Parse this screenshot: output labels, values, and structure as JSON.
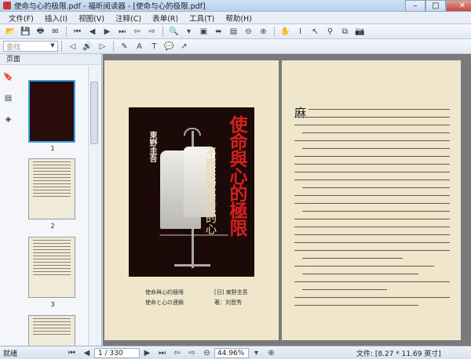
{
  "window": {
    "title": "使命与心的极限.pdf - 福昕阅读器 - [使命与心的极限.pdf]"
  },
  "menu": [
    "文件(F)",
    "插入(I)",
    "视图(V)",
    "注释(C)",
    "表单(R)",
    "工具(T)",
    "帮助(H)"
  ],
  "toolbar": {
    "search_placeholder": "查找"
  },
  "sidebar": {
    "title": "页面",
    "thumbs": [
      "1",
      "2",
      "3"
    ]
  },
  "document": {
    "cover": {
      "title": "使命與心的極限",
      "subtitle": "不應該被治癒的心",
      "author": "東野圭吾"
    },
    "left_caption": "使命與心的極限",
    "left_caption_right": "[日] 東野圭吾",
    "left_caption2": "使命と心の連鎖",
    "left_caption2_right": "著：刘晋秀",
    "right_dropcap": "麻"
  },
  "status": {
    "ready": "就绪",
    "page": "1 / 330",
    "zoom": "44.96%",
    "size": "文件: [8.27 * 11.69 英寸]"
  }
}
